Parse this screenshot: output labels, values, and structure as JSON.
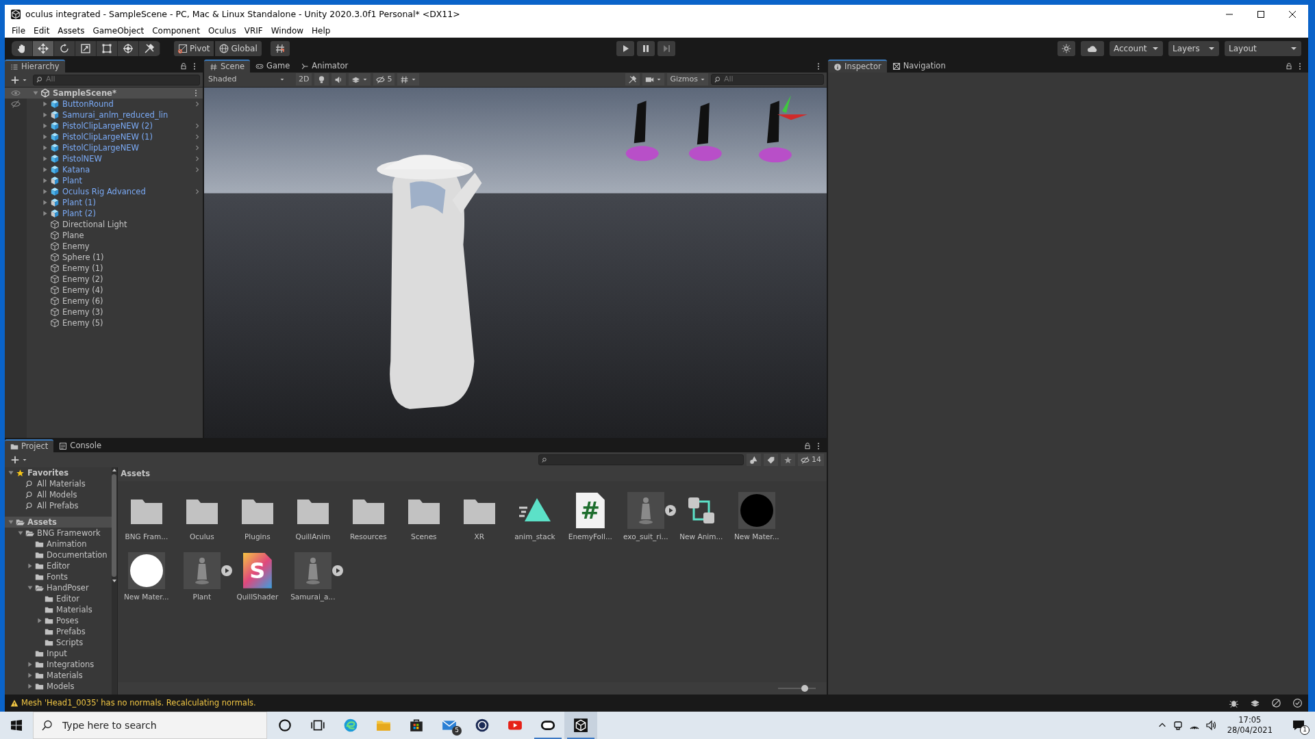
{
  "window": {
    "title": "oculus integrated - SampleScene - PC, Mac & Linux Standalone - Unity 2020.3.0f1 Personal* <DX11>"
  },
  "menu": [
    "File",
    "Edit",
    "Assets",
    "GameObject",
    "Component",
    "Oculus",
    "VRIF",
    "Window",
    "Help"
  ],
  "toolbar": {
    "tools": [
      {
        "kind": "hand",
        "selected": false
      },
      {
        "kind": "move",
        "selected": true
      },
      {
        "kind": "rotate",
        "selected": false
      },
      {
        "kind": "scale",
        "selected": false
      },
      {
        "kind": "rect",
        "selected": false
      },
      {
        "kind": "transform",
        "selected": false
      },
      {
        "kind": "custom",
        "selected": false
      }
    ],
    "pivot": "Pivot",
    "space": "Global",
    "account": "Account",
    "layers": "Layers",
    "layout": "Layout"
  },
  "hierarchy": {
    "tab": "Hierarchy",
    "search_placeholder": "All",
    "scene": "SampleScene*",
    "items": [
      {
        "label": "ButtonRound",
        "kind": "prefab",
        "arrow": true,
        "expanded": false,
        "chevron": true
      },
      {
        "label": "Samurai_anlm_reduced_lin",
        "kind": "model",
        "arrow": true,
        "expanded": false,
        "chevron": false
      },
      {
        "label": "PistolClipLargeNEW (2)",
        "kind": "prefab",
        "arrow": true,
        "expanded": false,
        "chevron": true
      },
      {
        "label": "PistolClipLargeNEW (1)",
        "kind": "prefab",
        "arrow": true,
        "expanded": false,
        "chevron": true
      },
      {
        "label": "PistolClipLargeNEW",
        "kind": "prefab",
        "arrow": true,
        "expanded": false,
        "chevron": true
      },
      {
        "label": "PistolNEW",
        "kind": "prefab",
        "arrow": true,
        "expanded": false,
        "chevron": true
      },
      {
        "label": "Katana",
        "kind": "prefab",
        "arrow": true,
        "expanded": false,
        "chevron": true
      },
      {
        "label": "Plant",
        "kind": "model",
        "arrow": true,
        "expanded": false,
        "chevron": false
      },
      {
        "label": "Oculus Rig Advanced",
        "kind": "prefab",
        "arrow": true,
        "expanded": false,
        "chevron": true
      },
      {
        "label": "Plant (1)",
        "kind": "model",
        "arrow": true,
        "expanded": false,
        "chevron": false
      },
      {
        "label": "Plant (2)",
        "kind": "model",
        "arrow": true,
        "expanded": false,
        "chevron": false
      },
      {
        "label": "Directional Light",
        "kind": "object",
        "arrow": false,
        "chevron": false
      },
      {
        "label": "Plane",
        "kind": "object",
        "arrow": false,
        "chevron": false
      },
      {
        "label": "Enemy",
        "kind": "object",
        "arrow": false,
        "chevron": false
      },
      {
        "label": "Sphere (1)",
        "kind": "object",
        "arrow": false,
        "chevron": false
      },
      {
        "label": "Enemy (1)",
        "kind": "object",
        "arrow": false,
        "chevron": false
      },
      {
        "label": "Enemy (2)",
        "kind": "object",
        "arrow": false,
        "chevron": false
      },
      {
        "label": "Enemy (4)",
        "kind": "object",
        "arrow": false,
        "chevron": false
      },
      {
        "label": "Enemy (6)",
        "kind": "object",
        "arrow": false,
        "chevron": false
      },
      {
        "label": "Enemy (3)",
        "kind": "object",
        "arrow": false,
        "chevron": false
      },
      {
        "label": "Enemy (5)",
        "kind": "object",
        "arrow": false,
        "chevron": false
      }
    ]
  },
  "scene_view": {
    "tabs": [
      {
        "label": "Scene",
        "kind": "scene",
        "selected": true
      },
      {
        "label": "Game",
        "kind": "game",
        "selected": false
      },
      {
        "label": "Animator",
        "kind": "animator",
        "selected": false
      }
    ],
    "shading": "Shaded",
    "mode_2d": "2D",
    "hidden_count": "5",
    "gizmos": "Gizmos",
    "search_placeholder": "All"
  },
  "inspector": {
    "tabs": [
      {
        "label": "Inspector",
        "kind": "inspector",
        "selected": true
      },
      {
        "label": "Navigation",
        "kind": "navigation",
        "selected": false
      }
    ]
  },
  "project": {
    "tabs": [
      {
        "label": "Project",
        "kind": "project",
        "selected": true
      },
      {
        "label": "Console",
        "kind": "console",
        "selected": false
      }
    ],
    "hidden_count": "14",
    "path": "Assets",
    "tree": [
      {
        "label": "Favorites",
        "kind": "favorites",
        "arrow": true,
        "expanded": true,
        "selected": false,
        "children": [
          {
            "label": "All Materials",
            "kind": "search",
            "arrow": false,
            "selected": false
          },
          {
            "label": "All Models",
            "kind": "search",
            "arrow": false,
            "selected": false
          },
          {
            "label": "All Prefabs",
            "kind": "search",
            "arrow": false,
            "selected": false
          }
        ]
      },
      {
        "label": "Assets",
        "kind": "folder",
        "arrow": true,
        "expanded": true,
        "selected": true,
        "children": [
          {
            "label": "BNG Framework",
            "kind": "folder",
            "arrow": true,
            "expanded": true,
            "selected": false,
            "children": [
              {
                "label": "Animation",
                "kind": "folder",
                "arrow": false,
                "expanded": false,
                "selected": false
              },
              {
                "label": "Documentation",
                "kind": "folder",
                "arrow": false,
                "expanded": false,
                "selected": false
              },
              {
                "label": "Editor",
                "kind": "folder",
                "arrow": true,
                "expanded": false,
                "selected": false
              },
              {
                "label": "Fonts",
                "kind": "folder",
                "arrow": false,
                "expanded": false,
                "selected": false
              },
              {
                "label": "HandPoser",
                "kind": "folder",
                "arrow": true,
                "expanded": true,
                "selected": false,
                "children": [
                  {
                    "label": "Editor",
                    "kind": "folder",
                    "arrow": false,
                    "expanded": false,
                    "selected": false
                  },
                  {
                    "label": "Materials",
                    "kind": "folder",
                    "arrow": false,
                    "expanded": false,
                    "selected": false
                  },
                  {
                    "label": "Poses",
                    "kind": "folder",
                    "arrow": true,
                    "expanded": false,
                    "selected": false
                  },
                  {
                    "label": "Prefabs",
                    "kind": "folder",
                    "arrow": false,
                    "expanded": false,
                    "selected": false
                  },
                  {
                    "label": "Scripts",
                    "kind": "folder",
                    "arrow": false,
                    "expanded": false,
                    "selected": false
                  }
                ]
              },
              {
                "label": "Input",
                "kind": "folder",
                "arrow": false,
                "expanded": false,
                "selected": false
              },
              {
                "label": "Integrations",
                "kind": "folder",
                "arrow": true,
                "expanded": false,
                "selected": false
              },
              {
                "label": "Materials",
                "kind": "folder",
                "arrow": true,
                "expanded": false,
                "selected": false
              },
              {
                "label": "Models",
                "kind": "folder",
                "arrow": true,
                "expanded": false,
                "selected": false
              }
            ]
          }
        ]
      }
    ],
    "assets": [
      {
        "label": "BNG Fram...",
        "kind": "folder"
      },
      {
        "label": "Oculus",
        "kind": "folder"
      },
      {
        "label": "Plugins",
        "kind": "folder"
      },
      {
        "label": "QuillAnim",
        "kind": "folder"
      },
      {
        "label": "Resources",
        "kind": "folder"
      },
      {
        "label": "Scenes",
        "kind": "folder"
      },
      {
        "label": "XR",
        "kind": "folder"
      },
      {
        "label": "anim_stack",
        "kind": "animation"
      },
      {
        "label": "EnemyFoll...",
        "kind": "script",
        "glyph": "#"
      },
      {
        "label": "exo_suit_ri...",
        "kind": "model"
      },
      {
        "label": "New Anim...",
        "kind": "controller"
      },
      {
        "label": "New Mater...",
        "kind": "material",
        "color": "#000000"
      },
      {
        "label": "New Mater...",
        "kind": "material",
        "color": "#ffffff"
      },
      {
        "label": "Plant",
        "kind": "model"
      },
      {
        "label": "QuillShader",
        "kind": "shader",
        "glyph": "S"
      },
      {
        "label": "Samurai_a...",
        "kind": "model"
      }
    ],
    "icon_size": {
      "level": 0.7
    }
  },
  "status_bar": {
    "message": "Mesh 'Head1_0035' has no normals. Recalculating normals."
  },
  "taskbar": {
    "search_placeholder": "Type here to search",
    "apps": [
      {
        "kind": "cortana",
        "running": false,
        "active": false
      },
      {
        "kind": "taskview",
        "running": false,
        "active": false
      },
      {
        "kind": "edge",
        "running": false,
        "active": false
      },
      {
        "kind": "explorer",
        "running": false,
        "active": false
      },
      {
        "kind": "store",
        "running": false,
        "active": false
      },
      {
        "kind": "mail",
        "running": false,
        "active": false,
        "badge": "5"
      },
      {
        "kind": "sphere",
        "running": false,
        "active": false
      },
      {
        "kind": "youtube",
        "running": false,
        "active": false
      },
      {
        "kind": "oculus",
        "running": true,
        "active": false
      },
      {
        "kind": "unity",
        "running": true,
        "active": true
      }
    ],
    "time": "17:05",
    "date": "28/04/2021",
    "notifications": "1"
  }
}
